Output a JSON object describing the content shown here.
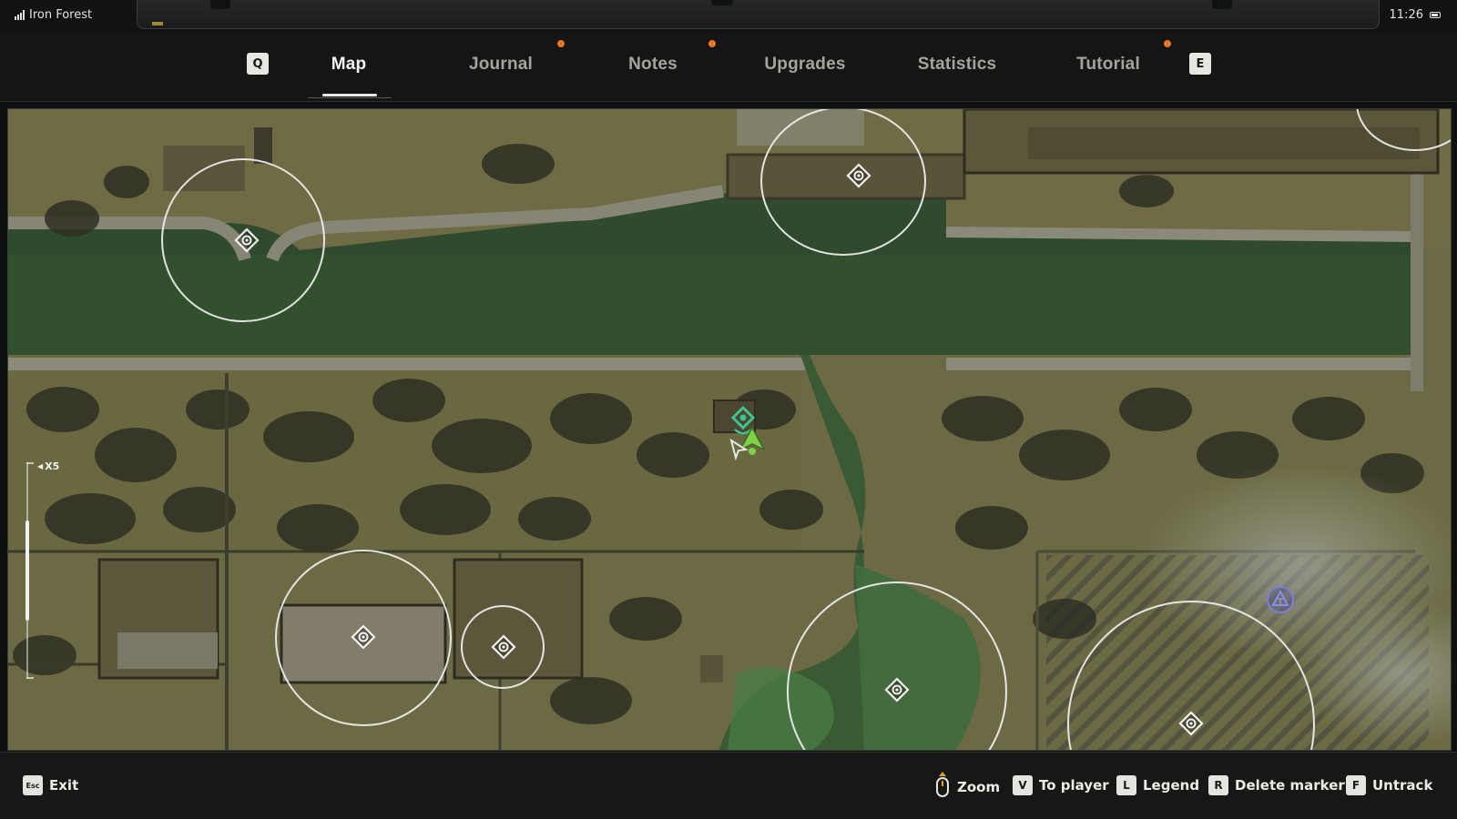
{
  "status": {
    "carrier": "Iron Forest",
    "time": "11:26"
  },
  "nav": {
    "prev_key": "Q",
    "next_key": "E",
    "tabs": [
      {
        "label": "Map",
        "active": true,
        "notify": false
      },
      {
        "label": "Journal",
        "active": false,
        "notify": true
      },
      {
        "label": "Notes",
        "active": false,
        "notify": true
      },
      {
        "label": "Upgrades",
        "active": false,
        "notify": false
      },
      {
        "label": "Statistics",
        "active": false,
        "notify": false
      },
      {
        "label": "Tutorial",
        "active": false,
        "notify": true
      }
    ],
    "notify_color": "#e8781f"
  },
  "map": {
    "zoom_label": "X5",
    "zoom_fraction": 0.5,
    "player_icon": "player-arrow-icon",
    "waypoint_icon": "waypoint-diamond-icon",
    "point_of_interest_icon": "poi-marker-icon",
    "faction_icon": "triangle-faction-icon",
    "circle_color": "#f0f0f0",
    "player_color": "#7fd14a",
    "waypoint_color": "#3fc38f",
    "faction_color": "#7b7fd6"
  },
  "hints": {
    "exit": {
      "key": "Esc",
      "label": "Exit"
    },
    "zoom": {
      "key": "scroll-wheel-icon",
      "label": "Zoom"
    },
    "to_player": {
      "key": "V",
      "label": "To player"
    },
    "legend": {
      "key": "L",
      "label": "Legend"
    },
    "delete_marker": {
      "key": "R",
      "label": "Delete marker"
    },
    "untrack": {
      "key": "F",
      "label": "Untrack"
    }
  }
}
